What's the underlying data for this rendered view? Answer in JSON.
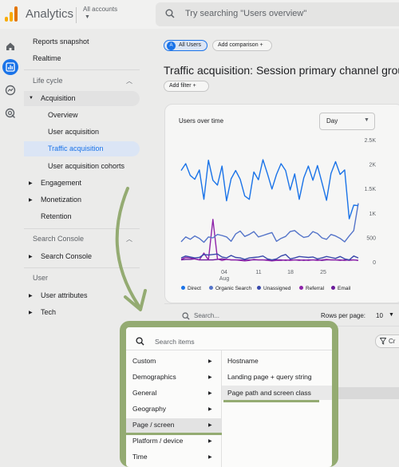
{
  "header": {
    "app_title": "Analytics",
    "account_label": "All accounts",
    "search_placeholder": "Try searching \"Users overview\""
  },
  "colors": {
    "accent": "#1a73e8",
    "highlight": "#94ab72",
    "logo": [
      "#f9ab00",
      "#e37400"
    ]
  },
  "rail_icons": [
    "home-icon",
    "reports-icon",
    "explore-icon",
    "advertising-icon"
  ],
  "nav": {
    "top_items": [
      "Reports snapshot",
      "Realtime"
    ],
    "lifecycle": {
      "title": "Life cycle",
      "acquisition": "Acquisition",
      "acquisition_children": [
        "Overview",
        "User acquisition",
        "Traffic acquisition",
        "User acquisition cohorts"
      ],
      "active_child": "Traffic acquisition",
      "others": [
        "Engagement",
        "Monetization",
        "Retention"
      ]
    },
    "search_console": {
      "title": "Search Console",
      "item": "Search Console"
    },
    "user": {
      "title": "User",
      "items": [
        "User attributes",
        "Tech"
      ]
    }
  },
  "main": {
    "chip_users": "All Users",
    "chip_users_badge": "A",
    "chip_comparison": "Add comparison",
    "add_filter": "Add filter",
    "page_title": "Traffic acquisition: Session primary channel group (",
    "chart_title": "Users over time",
    "period": "Day",
    "table_search_placeholder": "Search...",
    "rows_per_page_label": "Rows per page:",
    "rows_per_page_value": "10",
    "filter_button": "Cr"
  },
  "chart_data": {
    "type": "line",
    "x_tick_labels": [
      "04",
      "Aug",
      "11",
      "18",
      "25"
    ],
    "y_ticks": [
      "2.5K",
      "2K",
      "1.5K",
      "1K",
      "500",
      "0"
    ],
    "ylim": [
      0,
      2500
    ],
    "series": [
      {
        "name": "Direct",
        "color": "#1a73e8",
        "values": [
          1870,
          2010,
          1770,
          1690,
          1880,
          1280,
          2080,
          1670,
          1570,
          1960,
          1250,
          1700,
          1870,
          1690,
          1350,
          1280,
          1840,
          1680,
          2090,
          1800,
          1490,
          1790,
          2010,
          1870,
          1470,
          1800,
          1280,
          1720,
          1960,
          1670,
          1970,
          1620,
          1260,
          1810,
          2050,
          1790,
          1880,
          880,
          1160,
          1150
        ]
      },
      {
        "name": "Organic Search",
        "color": "#5474c9",
        "values": [
          410,
          510,
          460,
          530,
          480,
          400,
          510,
          490,
          560,
          540,
          510,
          420,
          570,
          630,
          520,
          560,
          620,
          510,
          540,
          570,
          600,
          420,
          480,
          520,
          620,
          640,
          560,
          500,
          520,
          620,
          580,
          490,
          460,
          560,
          530,
          480,
          410,
          530,
          640,
          1200
        ]
      },
      {
        "name": "Unassigned",
        "color": "#3949ab",
        "values": [
          80,
          120,
          100,
          80,
          90,
          150,
          140,
          150,
          160,
          100,
          80,
          130,
          90,
          80,
          50,
          80,
          90,
          100,
          120,
          60,
          40,
          60,
          120,
          150,
          60,
          80,
          110,
          100,
          90,
          100,
          60,
          80,
          110,
          90,
          70,
          110,
          60,
          40,
          120,
          80
        ]
      },
      {
        "name": "Referral",
        "color": "#8e24aa",
        "values": [
          50,
          90,
          80,
          60,
          40,
          180,
          40,
          870,
          60,
          30,
          50,
          40,
          40,
          30,
          20,
          30,
          50,
          40,
          40,
          30,
          20,
          30,
          30,
          40,
          30,
          40,
          30,
          40,
          30,
          40,
          30,
          40,
          50,
          40,
          40,
          30,
          40,
          30,
          40,
          30
        ]
      },
      {
        "name": "Email",
        "color": "#6a1b9a",
        "values": [
          40,
          50,
          50,
          60,
          40,
          40,
          40,
          40,
          50,
          60,
          50,
          40,
          40,
          40,
          30,
          40,
          40,
          40,
          40,
          40,
          30,
          40,
          40,
          30,
          40,
          40,
          40,
          30,
          40,
          40,
          40,
          30,
          40,
          40,
          40,
          40,
          30,
          40,
          40,
          30
        ]
      }
    ]
  },
  "popup": {
    "search_placeholder": "Search items",
    "categories": [
      "Custom",
      "Demographics",
      "General",
      "Geography",
      "Page / screen",
      "Platform / device",
      "Time"
    ],
    "selected_category": "Page / screen",
    "options": [
      "Hostname",
      "Landing page + query string",
      "Page path and screen class"
    ],
    "selected_option": "Page path and screen class"
  }
}
